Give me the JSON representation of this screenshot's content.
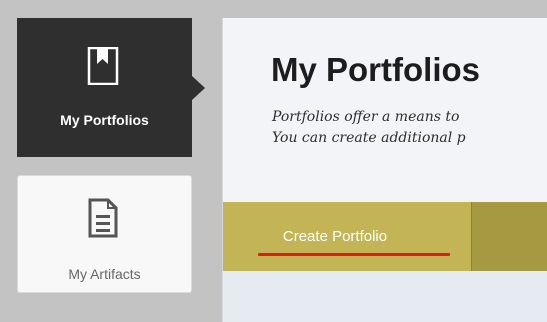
{
  "sidebar": {
    "items": [
      {
        "label": "My Portfolios",
        "icon": "notebook-icon",
        "active": true
      },
      {
        "label": "My Artifacts",
        "icon": "document-icon",
        "active": false
      }
    ]
  },
  "main": {
    "title": "My Portfolios",
    "description_line1": "Portfolios offer a means to",
    "description_line2": "You can create additional p",
    "create_button_label": "Create Portfolio"
  },
  "colors": {
    "active_tile": "#2f2f2f",
    "action_bar": "#a59a42",
    "button": "#c3b555",
    "highlight_underline": "#e11b1b"
  }
}
